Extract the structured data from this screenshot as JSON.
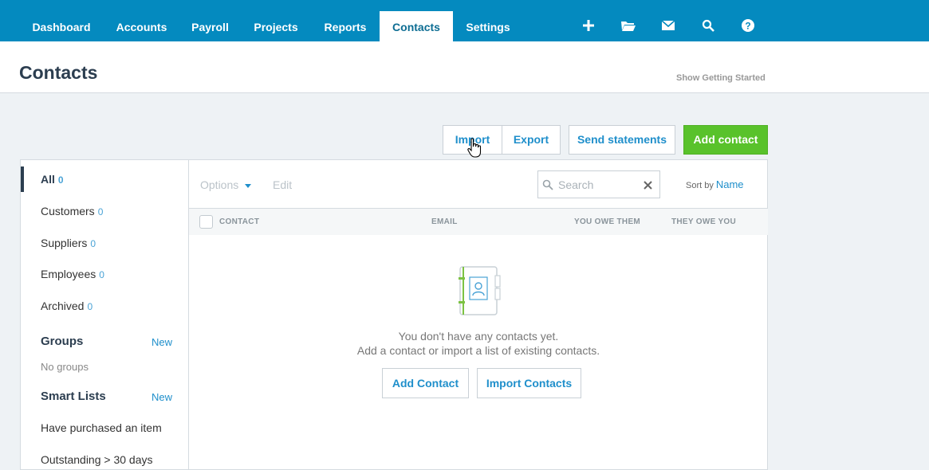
{
  "nav": {
    "tabs": [
      {
        "label": "Dashboard"
      },
      {
        "label": "Accounts"
      },
      {
        "label": "Payroll"
      },
      {
        "label": "Projects"
      },
      {
        "label": "Reports"
      },
      {
        "label": "Contacts"
      },
      {
        "label": "Settings"
      }
    ],
    "icons": [
      "plus-icon",
      "folder-icon",
      "mail-icon",
      "search-icon",
      "help-icon"
    ],
    "active_tab": "Contacts"
  },
  "header": {
    "title": "Contacts",
    "getting_started": "Show Getting Started"
  },
  "actions": {
    "import": "Import",
    "export": "Export",
    "send_statements": "Send statements",
    "add_contact": "Add contact"
  },
  "sidebar": {
    "items": [
      {
        "label": "All",
        "count": "0"
      },
      {
        "label": "Customers",
        "count": "0"
      },
      {
        "label": "Suppliers",
        "count": "0"
      },
      {
        "label": "Employees",
        "count": "0"
      },
      {
        "label": "Archived",
        "count": "0"
      }
    ],
    "groups": {
      "title": "Groups",
      "new": "New",
      "empty": "No groups"
    },
    "smart_lists": {
      "title": "Smart Lists",
      "new": "New",
      "items": [
        "Have purchased an item",
        "Outstanding > 30 days"
      ]
    }
  },
  "toolbar": {
    "options": "Options",
    "edit": "Edit",
    "search_placeholder": "Search",
    "sort_by": "Sort by",
    "sort_field": "Name"
  },
  "columns": {
    "contact": "CONTACT",
    "email": "EMAIL",
    "you_owe_them": "YOU OWE THEM",
    "they_owe_you": "THEY OWE YOU"
  },
  "empty_state": {
    "line1": "You don't have any contacts yet.",
    "line2": "Add a contact or import a list of existing contacts.",
    "add_contact": "Add Contact",
    "import_contacts": "Import Contacts"
  },
  "colors": {
    "nav_bg": "#048abf",
    "accent": "#1f8fcb",
    "primary_button": "#59c22b"
  }
}
